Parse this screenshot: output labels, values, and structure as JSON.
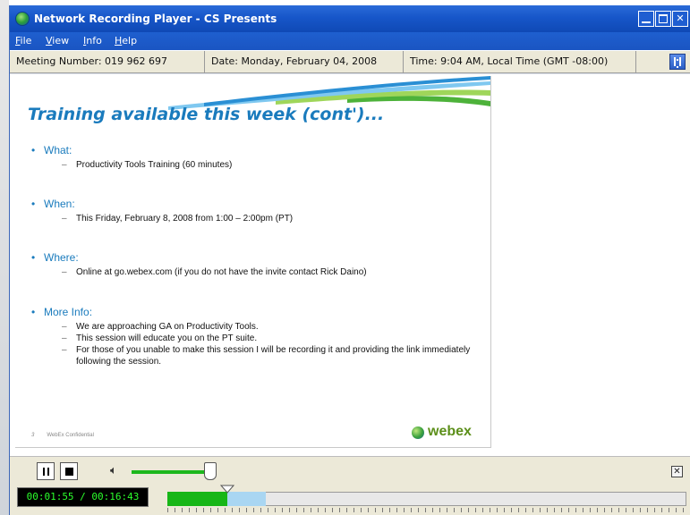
{
  "window": {
    "title": "Network Recording Player - CS Presents"
  },
  "menu": {
    "items": [
      {
        "acc": "F",
        "rest": "ile"
      },
      {
        "acc": "V",
        "rest": "iew"
      },
      {
        "acc": "I",
        "rest": "nfo"
      },
      {
        "acc": "H",
        "rest": "elp"
      }
    ]
  },
  "info_bar": {
    "meeting": "Meeting Number: 019 962 697",
    "date": "Date: Monday, February 04, 2008",
    "time": "Time: 9:04 AM, Local Time (GMT -08:00)"
  },
  "slide": {
    "title": "Training available this week (cont')...",
    "sections": [
      {
        "heading": "What:",
        "items": [
          "Productivity Tools Training (60 minutes)"
        ]
      },
      {
        "heading": "When:",
        "items": [
          "This Friday, February 8, 2008 from 1:00 – 2:00pm (PT)"
        ]
      },
      {
        "heading": "Where:",
        "items": [
          "Online at go.webex.com (if you do not have the invite contact Rick Daino)"
        ]
      },
      {
        "heading": "More Info:",
        "items": [
          "We are approaching GA on Productivity Tools.",
          "This session will educate you on the PT suite.",
          "For those of you unable to make this session I will be recording it and providing the link immediately following the session."
        ]
      }
    ],
    "footer_page": "3",
    "footer_text": "WebEx Confidential",
    "logo_text": "webex"
  },
  "player": {
    "time_display": "00:01:55 / 00:16:43",
    "elapsed_seconds": 115,
    "total_seconds": 1003,
    "buffered_fraction": 0.19,
    "volume_fraction": 0.92
  },
  "colors": {
    "title_bar": "#1756c9",
    "slide_title": "#1a7bbd",
    "progress": "#17b617",
    "buffer": "#a9d6f2",
    "volume": "#1db81d"
  }
}
